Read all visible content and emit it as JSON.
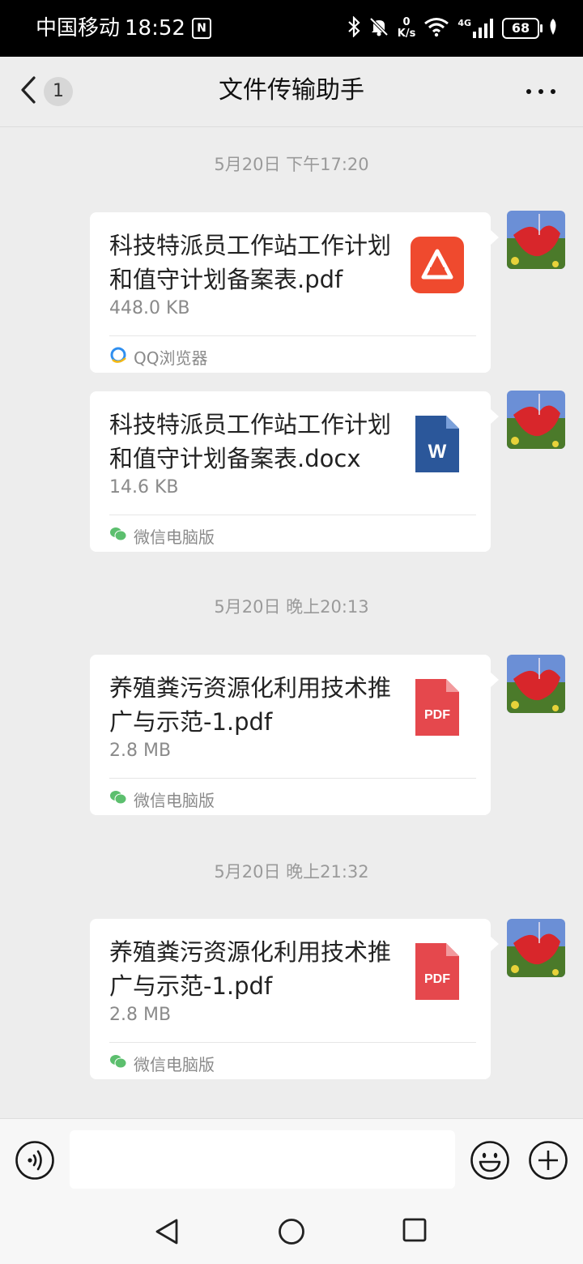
{
  "status_bar": {
    "carrier": "中国移动",
    "time": "18:52",
    "nfc": "N",
    "speed_value": "0",
    "speed_unit": "K/s",
    "network": "4G",
    "battery": "68"
  },
  "header": {
    "back_count": "1",
    "title": "文件传输助手"
  },
  "messages": [
    {
      "timestamp": "5月20日 下午17:20",
      "file_name": "科技特派员工作站工作计划和值守计划备案表.pdf",
      "file_size": "448.0 KB",
      "source": "QQ浏览器",
      "icon": "qq-browser-pdf-icon"
    },
    {
      "file_name": "科技特派员工作站工作计划和值守计划备案表.docx",
      "file_size": "14.6 KB",
      "source": "微信电脑版",
      "icon_letter": "W"
    },
    {
      "timestamp": "5月20日 晚上20:13",
      "file_name": "养殖粪污资源化利用技术推广与示范-1.pdf",
      "file_size": "2.8 MB",
      "source": "微信电脑版",
      "icon_label": "PDF"
    },
    {
      "timestamp": "5月20日 晚上21:32",
      "file_name": "养殖粪污资源化利用技术推广与示范-1.pdf",
      "file_size": "2.8 MB",
      "source": "微信电脑版",
      "icon_label": "PDF"
    }
  ],
  "input_bar": {
    "placeholder": ""
  },
  "colors": {
    "background": "#ededed",
    "pdf_red": "#e5484d",
    "qq_pdf_red": "#ef4a2e",
    "word_blue": "#2b579a",
    "wechat_green": "#5cbf6e"
  }
}
